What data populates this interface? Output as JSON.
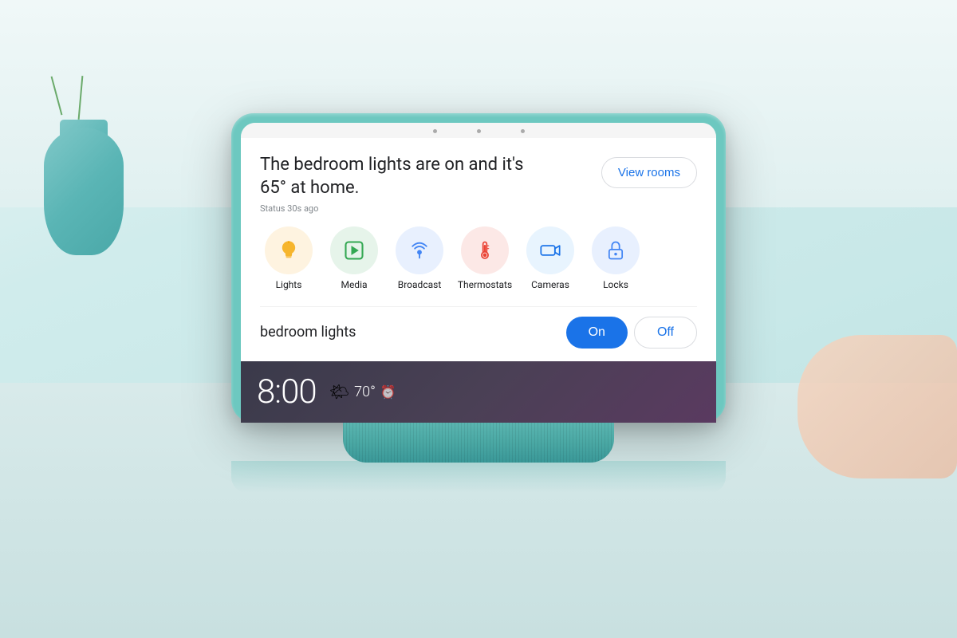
{
  "background": {
    "color": "#d0ecec"
  },
  "device": {
    "screen": {
      "status_message": "The bedroom lights are on and it's 65° at home.",
      "status_time": "Status 30s ago",
      "view_rooms_label": "View rooms",
      "actions": [
        {
          "id": "lights",
          "label": "Lights",
          "icon": "lightbulb",
          "color_class": "icon-lights"
        },
        {
          "id": "media",
          "label": "Media",
          "icon": "play",
          "color_class": "icon-media"
        },
        {
          "id": "broadcast",
          "label": "Broadcast",
          "icon": "broadcast",
          "color_class": "icon-broadcast"
        },
        {
          "id": "thermostats",
          "label": "Thermostats",
          "icon": "thermometer",
          "color_class": "icon-thermostats"
        },
        {
          "id": "cameras",
          "label": "Cameras",
          "icon": "camera",
          "color_class": "icon-cameras"
        },
        {
          "id": "locks",
          "label": "Locks",
          "icon": "lock",
          "color_class": "icon-locks"
        }
      ],
      "lights_control": {
        "label": "bedroom lights",
        "on_label": "On",
        "off_label": "Off"
      },
      "clock": {
        "time": "8:00",
        "temperature": "70°",
        "alarm_icon": "⏰"
      }
    }
  }
}
